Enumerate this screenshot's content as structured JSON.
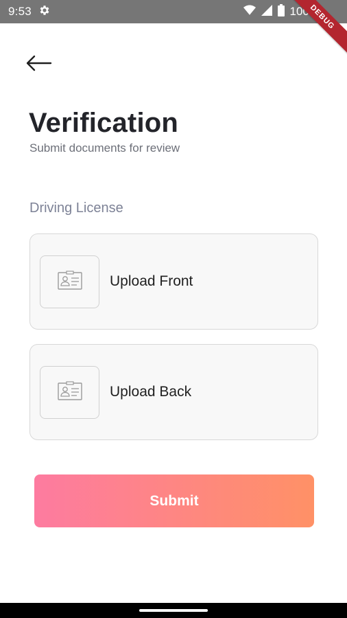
{
  "status_bar": {
    "time": "9:53",
    "battery": "100%",
    "icons": [
      "gear-icon",
      "wifi-icon",
      "signal-icon",
      "battery-icon"
    ]
  },
  "debug_banner": "DEBUG",
  "header": {
    "back_icon": "arrow-left-icon",
    "title": "Verification",
    "subtitle": "Submit documents for review"
  },
  "section": {
    "label": "Driving License"
  },
  "uploads": [
    {
      "label": "Upload Front",
      "icon": "id-card-icon"
    },
    {
      "label": "Upload Back",
      "icon": "id-card-icon"
    }
  ],
  "submit": {
    "label": "Submit",
    "gradient_start": "#fd7ba0",
    "gradient_end": "#ff9166"
  },
  "colors": {
    "status_bar_bg": "#767676",
    "title": "#23242a",
    "card_bg": "#f8f8f8",
    "card_border": "#d8d8d8"
  }
}
